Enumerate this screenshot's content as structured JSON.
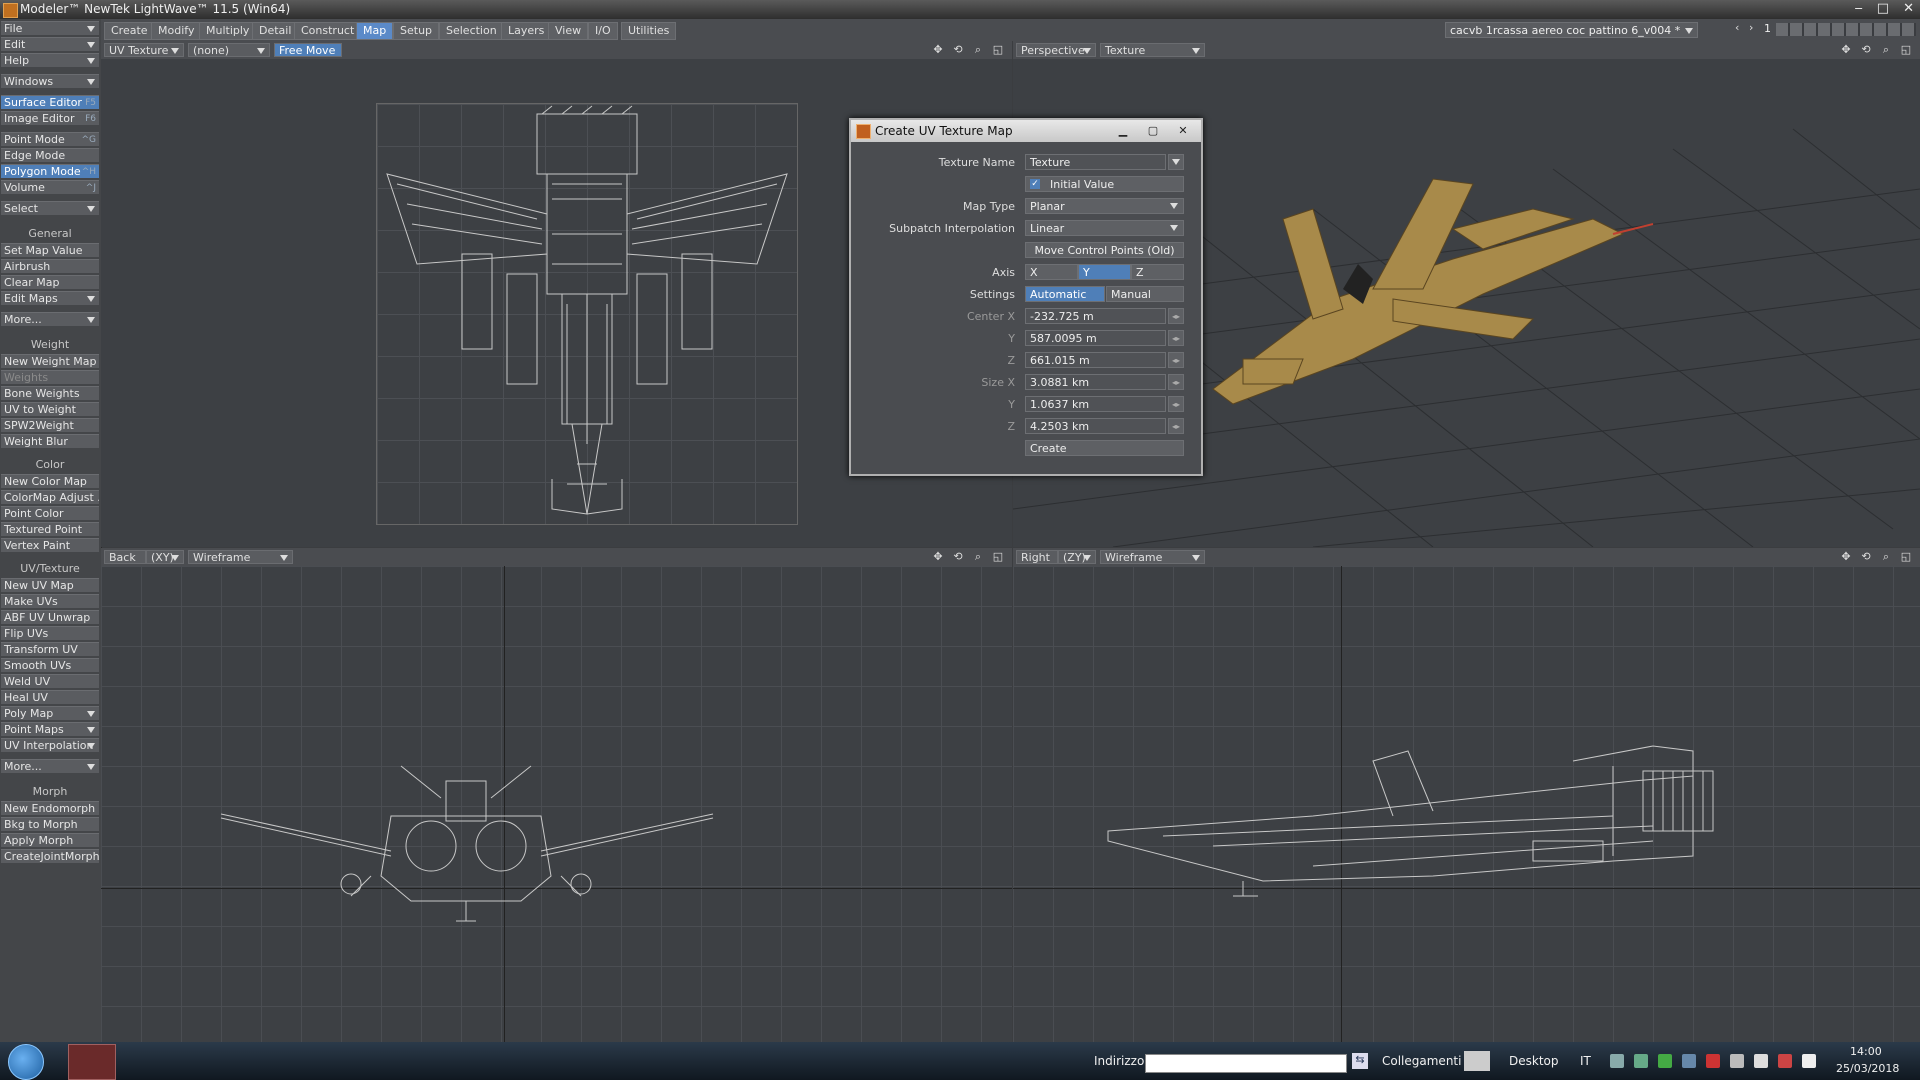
{
  "window": {
    "title": "Modeler™ NewTek LightWave™ 11.5 (Win64)",
    "min": "‒",
    "max": "□",
    "close": "✕"
  },
  "left_panel": {
    "top": [
      {
        "label": "File",
        "dd": true
      },
      {
        "label": "Edit",
        "dd": true
      },
      {
        "label": "Help",
        "dd": true
      },
      {
        "label": "Windows",
        "dd": true
      }
    ],
    "editors": [
      {
        "label": "Surface Editor",
        "key": "F5",
        "hl": true
      },
      {
        "label": "Image Editor",
        "key": "F6"
      }
    ],
    "modes": [
      {
        "label": "Point Mode",
        "key": "^G"
      },
      {
        "label": "Edge Mode",
        "key": ""
      },
      {
        "label": "Polygon Mode",
        "key": "^H",
        "hl": true
      },
      {
        "label": "Volume",
        "key": "^J"
      }
    ],
    "select": "Select",
    "general_header": "General",
    "general": [
      "Set Map Value",
      "Airbrush",
      "Clear Map",
      "Edit Maps",
      "More..."
    ],
    "weight_header": "Weight",
    "weight": [
      "New Weight Map",
      "Weights",
      "Bone Weights",
      "UV to Weight",
      "SPW2Weight",
      "Weight Blur"
    ],
    "color_header": "Color",
    "color": [
      "New Color Map",
      "ColorMap Adjust ...",
      "Point Color",
      "Textured Point",
      "Vertex Paint"
    ],
    "uv_header": "UV/Texture",
    "uv": [
      "New UV Map",
      "Make UVs",
      "ABF UV Unwrap",
      "Flip UVs",
      "Transform UV",
      "Smooth UVs",
      "Weld UV",
      "Heal UV",
      "Poly Map",
      "Point Maps",
      "UV Interpolation",
      "More..."
    ],
    "morph_header": "Morph",
    "morph": [
      "New Endomorph",
      "Bkg to Morph",
      "Apply Morph",
      "CreateJointMorph"
    ]
  },
  "menu_tabs": [
    "Create",
    "Modify",
    "Multiply",
    "Detail",
    "Construct",
    "Map",
    "Setup",
    "Selection",
    "Layers",
    "View",
    "I/O",
    "Utilities"
  ],
  "active_tab": "Map",
  "layer_name": "cacvb 1rcassa aereo coc pattino 6_v004 *",
  "layer_number": "1",
  "viewports": {
    "top_left": {
      "view": "UV Texture",
      "map": "(none)",
      "mode": "Free Move"
    },
    "top_right": {
      "view": "Perspective",
      "render": "Texture"
    },
    "bottom_left": {
      "view": "Back",
      "axes": "(XY)",
      "render": "Wireframe"
    },
    "bottom_right": {
      "view": "Right",
      "axes": "(ZY)",
      "render": "Wireframe"
    }
  },
  "dialog": {
    "title": "Create UV Texture Map",
    "texture_name_label": "Texture Name",
    "texture_name": "Texture",
    "initial_value": "Initial Value",
    "map_type_label": "Map Type",
    "map_type": "Planar",
    "subpatch_label": "Subpatch Interpolation",
    "subpatch": "Linear",
    "move_cp": "Move Control Points (Old)",
    "axis_label": "Axis",
    "axis_x": "X",
    "axis_y": "Y",
    "axis_z": "Z",
    "settings_label": "Settings",
    "automatic": "Automatic",
    "manual": "Manual",
    "center_x_label": "Center X",
    "center_x": "-232.725 m",
    "center_y_label": "Y",
    "center_y": "587.0095 m",
    "center_z_label": "Z",
    "center_z": "661.015 m",
    "size_x_label": "Size X",
    "size_x": "3.0881 km",
    "size_y_label": "Y",
    "size_y": "1.0637 km",
    "size_z_label": "Z",
    "size_z": "4.2503 km",
    "create": "Create"
  },
  "taskbar": {
    "address_label": "Indirizzo",
    "links": "Collegamenti",
    "desktop": "Desktop",
    "lang": "IT",
    "time": "14:00",
    "date": "25/03/2018"
  }
}
